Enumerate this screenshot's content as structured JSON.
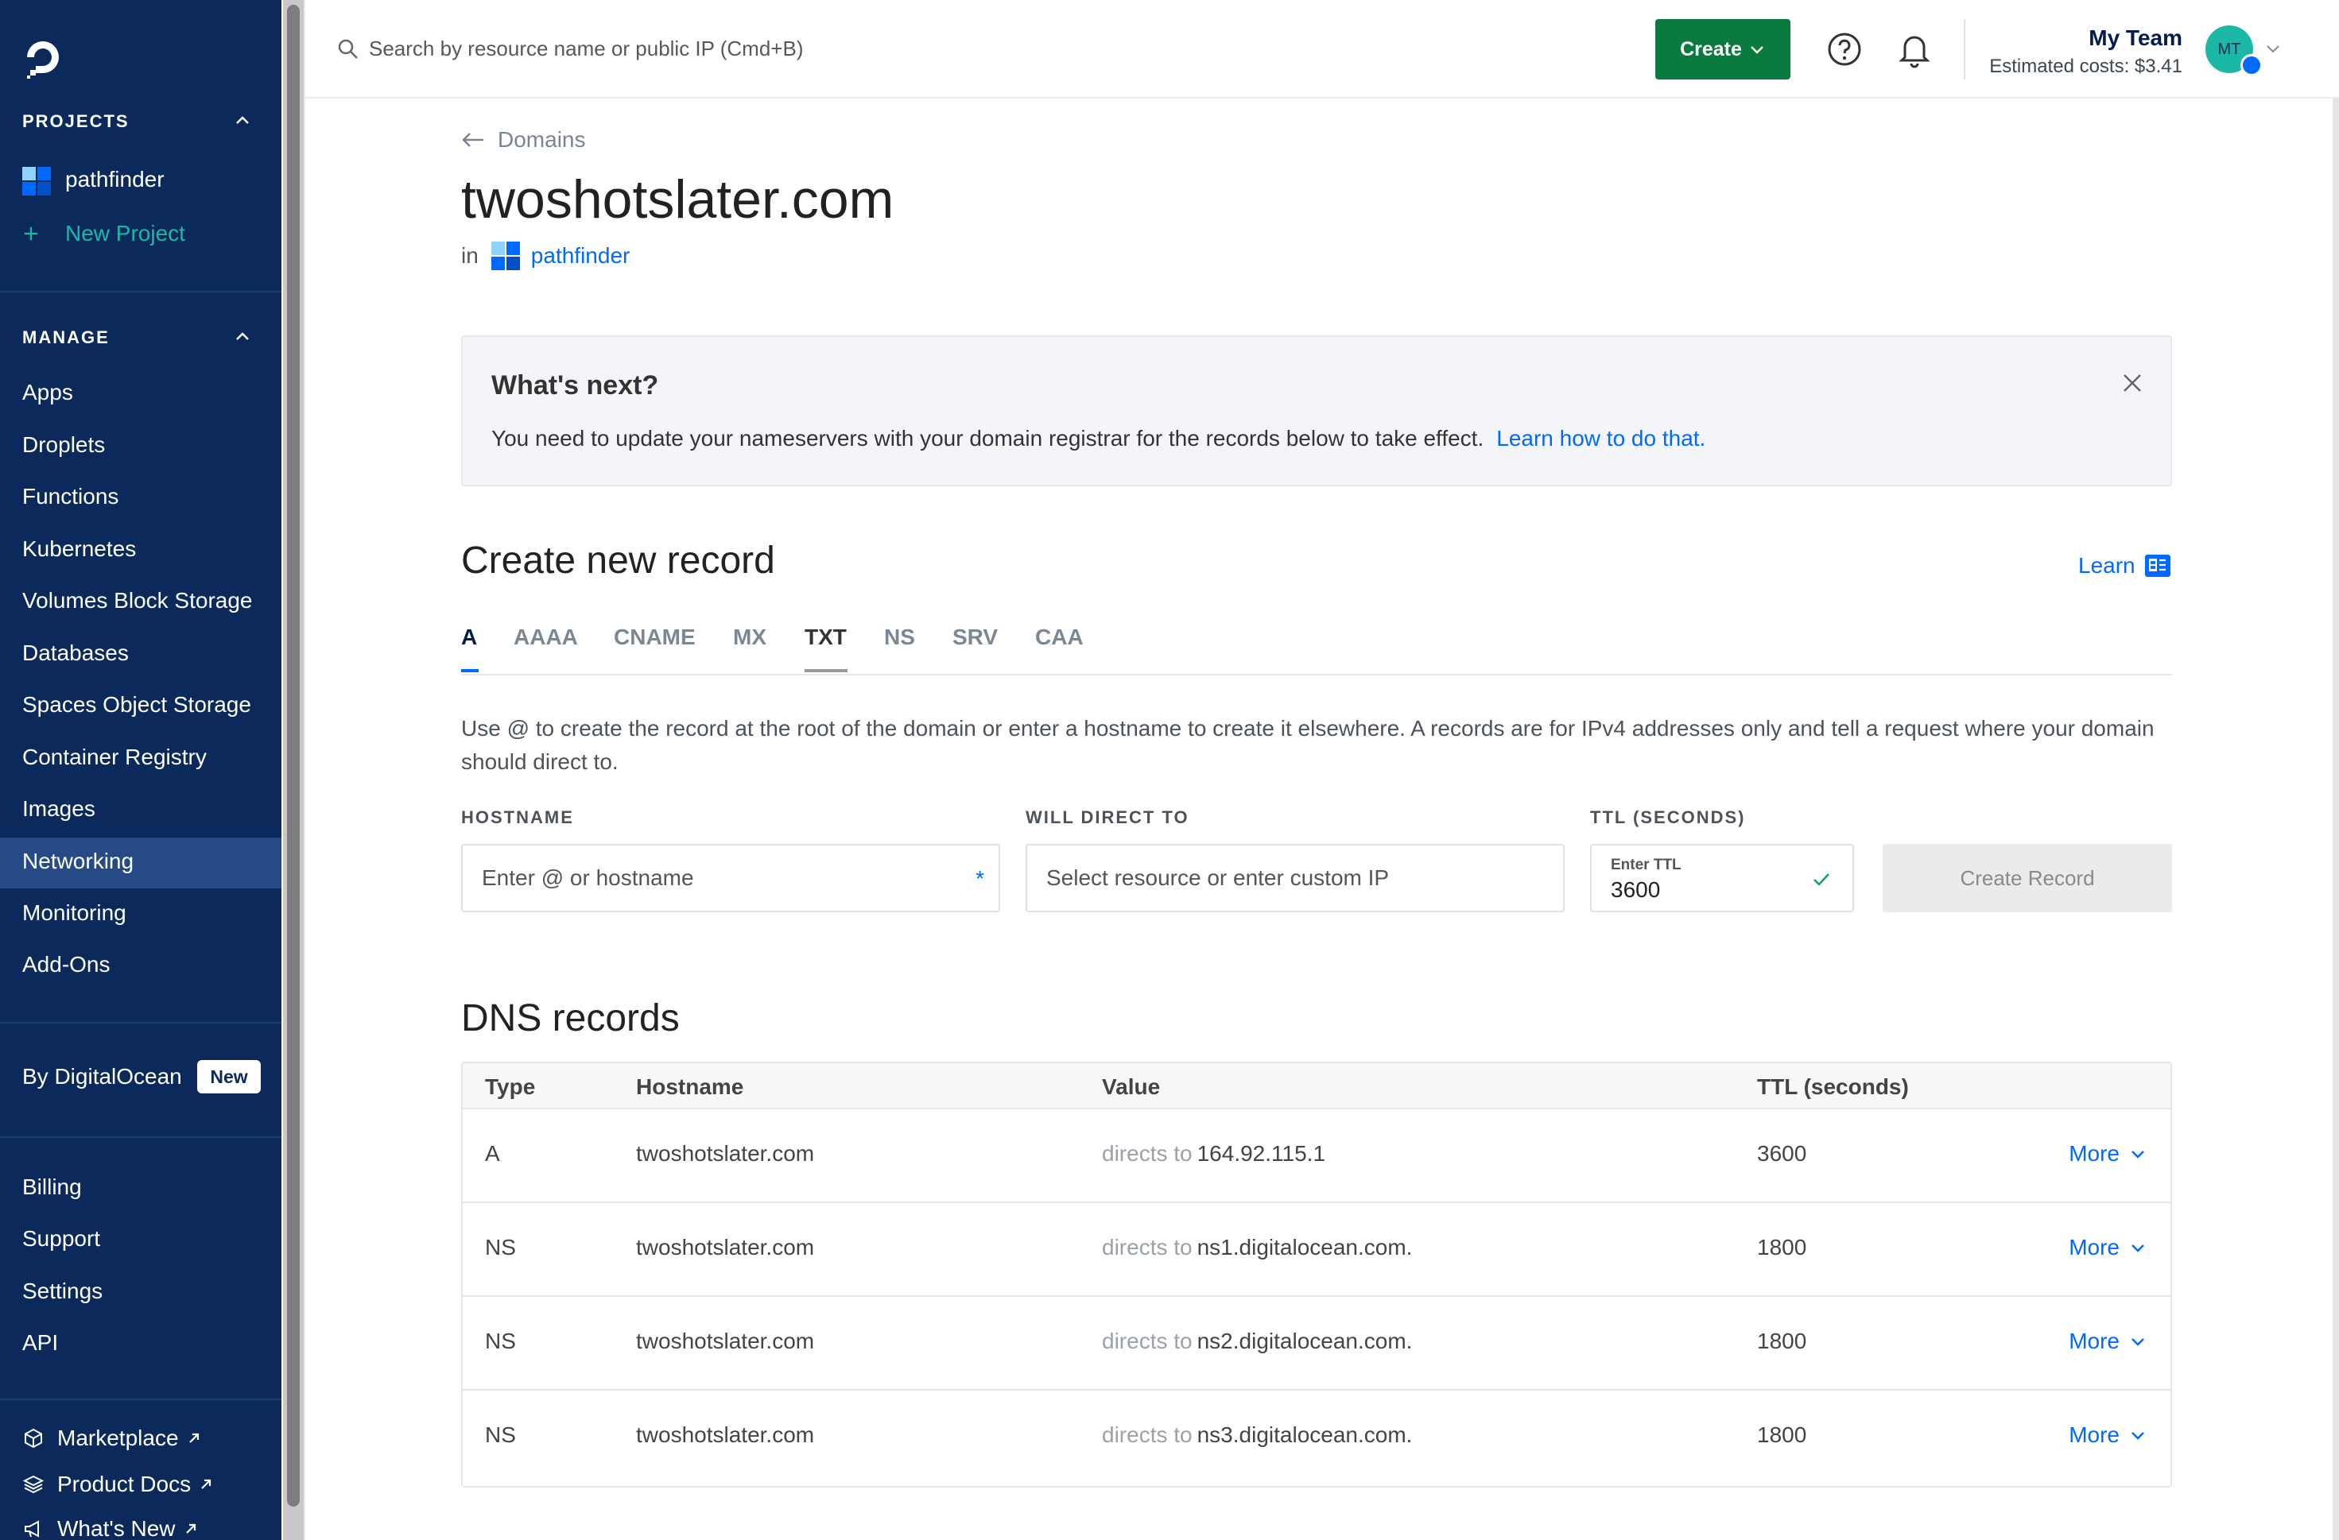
{
  "sidebar": {
    "projects_header": "PROJECTS",
    "project_name": "pathfinder",
    "new_project": "New Project",
    "manage_header": "MANAGE",
    "manage_items": [
      "Apps",
      "Droplets",
      "Functions",
      "Kubernetes",
      "Volumes Block Storage",
      "Databases",
      "Spaces Object Storage",
      "Container Registry",
      "Images",
      "Networking",
      "Monitoring",
      "Add-Ons"
    ],
    "active_item": "Networking",
    "by_do": "By DigitalOcean",
    "new_badge": "New",
    "account_items": [
      "Billing",
      "Support",
      "Settings",
      "API"
    ],
    "external_items": [
      "Marketplace",
      "Product Docs",
      "What's New"
    ]
  },
  "topbar": {
    "search_placeholder": "Search by resource name or public IP (Cmd+B)",
    "create_label": "Create",
    "team_name": "My Team",
    "estimated_costs": "Estimated costs: $3.41",
    "avatar_initials": "MT"
  },
  "page": {
    "breadcrumb": "Domains",
    "title": "twoshotslater.com",
    "in_label": "in",
    "project_link": "pathfinder"
  },
  "whats_next": {
    "title": "What's next?",
    "text": "You need to update your nameservers with your domain registrar for the records below to take effect.",
    "link": "Learn how to do that."
  },
  "create_record": {
    "title": "Create new record",
    "learn": "Learn",
    "tabs": [
      "A",
      "AAAA",
      "CNAME",
      "MX",
      "TXT",
      "NS",
      "SRV",
      "CAA"
    ],
    "active_tab": "A",
    "help": "Use @ to create the record at the root of the domain or enter a hostname to create it elsewhere. A records are for IPv4 addresses only and tell a request where your domain should direct to.",
    "hostname_label": "HOSTNAME",
    "hostname_placeholder": "Enter @ or hostname",
    "direct_label": "WILL DIRECT TO",
    "direct_placeholder": "Select resource or enter custom IP",
    "ttl_label": "TTL (SECONDS)",
    "ttl_mini_label": "Enter TTL",
    "ttl_value": "3600",
    "submit": "Create Record"
  },
  "dns": {
    "title": "DNS records",
    "columns": [
      "Type",
      "Hostname",
      "Value",
      "TTL (seconds)"
    ],
    "directs_to": "directs to",
    "more_label": "More",
    "rows": [
      {
        "type": "A",
        "hostname": "twoshotslater.com",
        "value": "164.92.115.1",
        "ttl": "3600"
      },
      {
        "type": "NS",
        "hostname": "twoshotslater.com",
        "value": "ns1.digitalocean.com.",
        "ttl": "1800"
      },
      {
        "type": "NS",
        "hostname": "twoshotslater.com",
        "value": "ns2.digitalocean.com.",
        "ttl": "1800"
      },
      {
        "type": "NS",
        "hostname": "twoshotslater.com",
        "value": "ns3.digitalocean.com.",
        "ttl": "1800"
      }
    ]
  },
  "colors": {
    "sidebar_bg": "#0b2a5b",
    "active_item_bg": "#254a85",
    "brand_blue": "#0069ff",
    "create_green": "#0a7a3f",
    "new_project_teal": "#1cb8a6"
  },
  "icons": [
    "digitalocean-logo-icon",
    "chevron-up-icon",
    "plus-icon",
    "search-icon",
    "chevron-down-icon",
    "help-circle-icon",
    "bell-icon",
    "arrow-left-icon",
    "close-icon",
    "docs-icon",
    "check-icon",
    "external-link-icon",
    "cube-icon",
    "layers-icon",
    "megaphone-icon"
  ]
}
